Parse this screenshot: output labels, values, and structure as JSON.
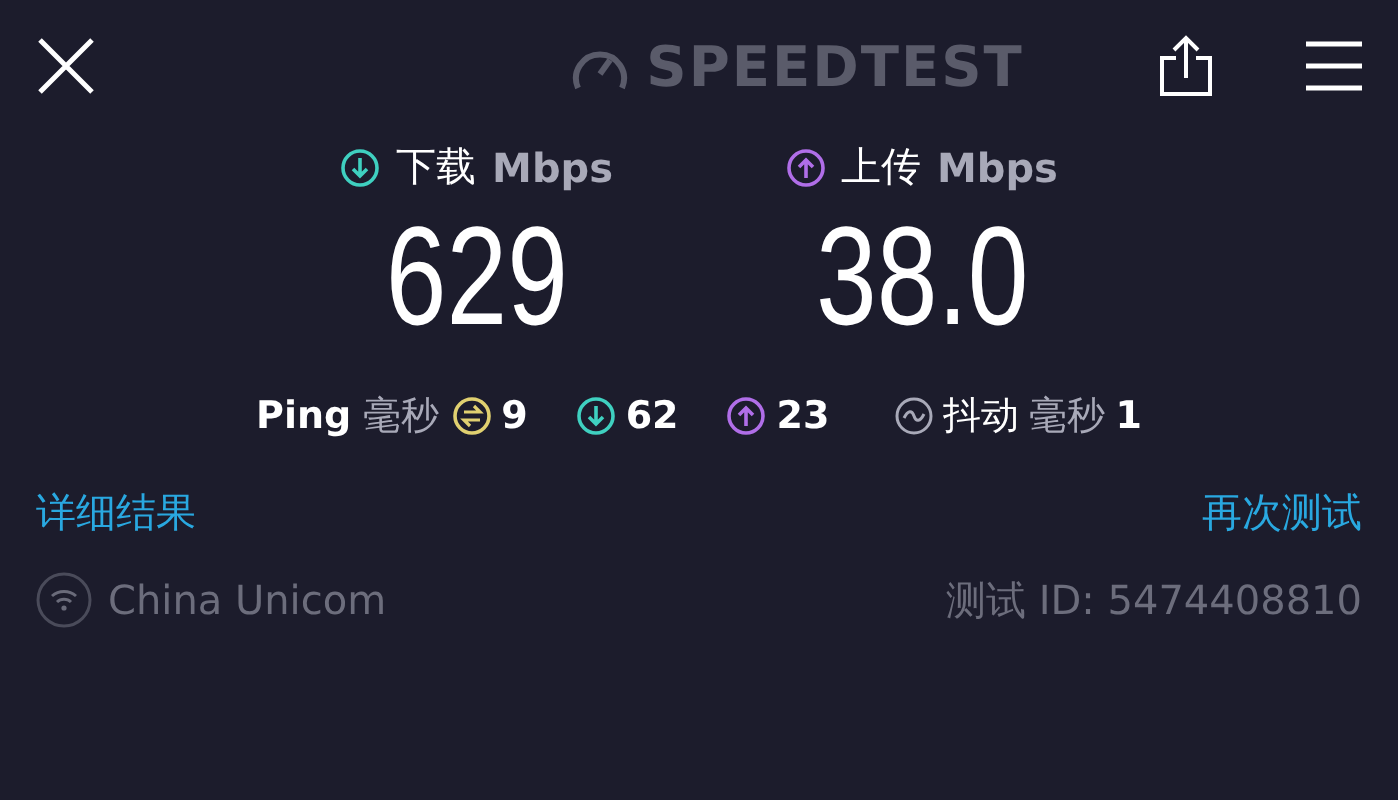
{
  "header": {
    "logo": "SPEEDTEST"
  },
  "speeds": [
    {
      "kind": "download",
      "label": "下载",
      "unit": "Mbps",
      "value": "629"
    },
    {
      "kind": "upload",
      "label": "上传",
      "unit": "Mbps",
      "value": "38.0"
    }
  ],
  "ping": {
    "label": "Ping",
    "unit": "毫秒",
    "items": [
      {
        "kind": "idle",
        "value": "9"
      },
      {
        "kind": "download",
        "value": "62"
      },
      {
        "kind": "upload",
        "value": "23"
      }
    ]
  },
  "jitter": {
    "label": "抖动",
    "unit": "毫秒",
    "value": "1"
  },
  "links": {
    "details": "详细结果",
    "retest": "再次测试"
  },
  "provider": "China Unicom",
  "test_id": "测试 ID: 5474408810"
}
